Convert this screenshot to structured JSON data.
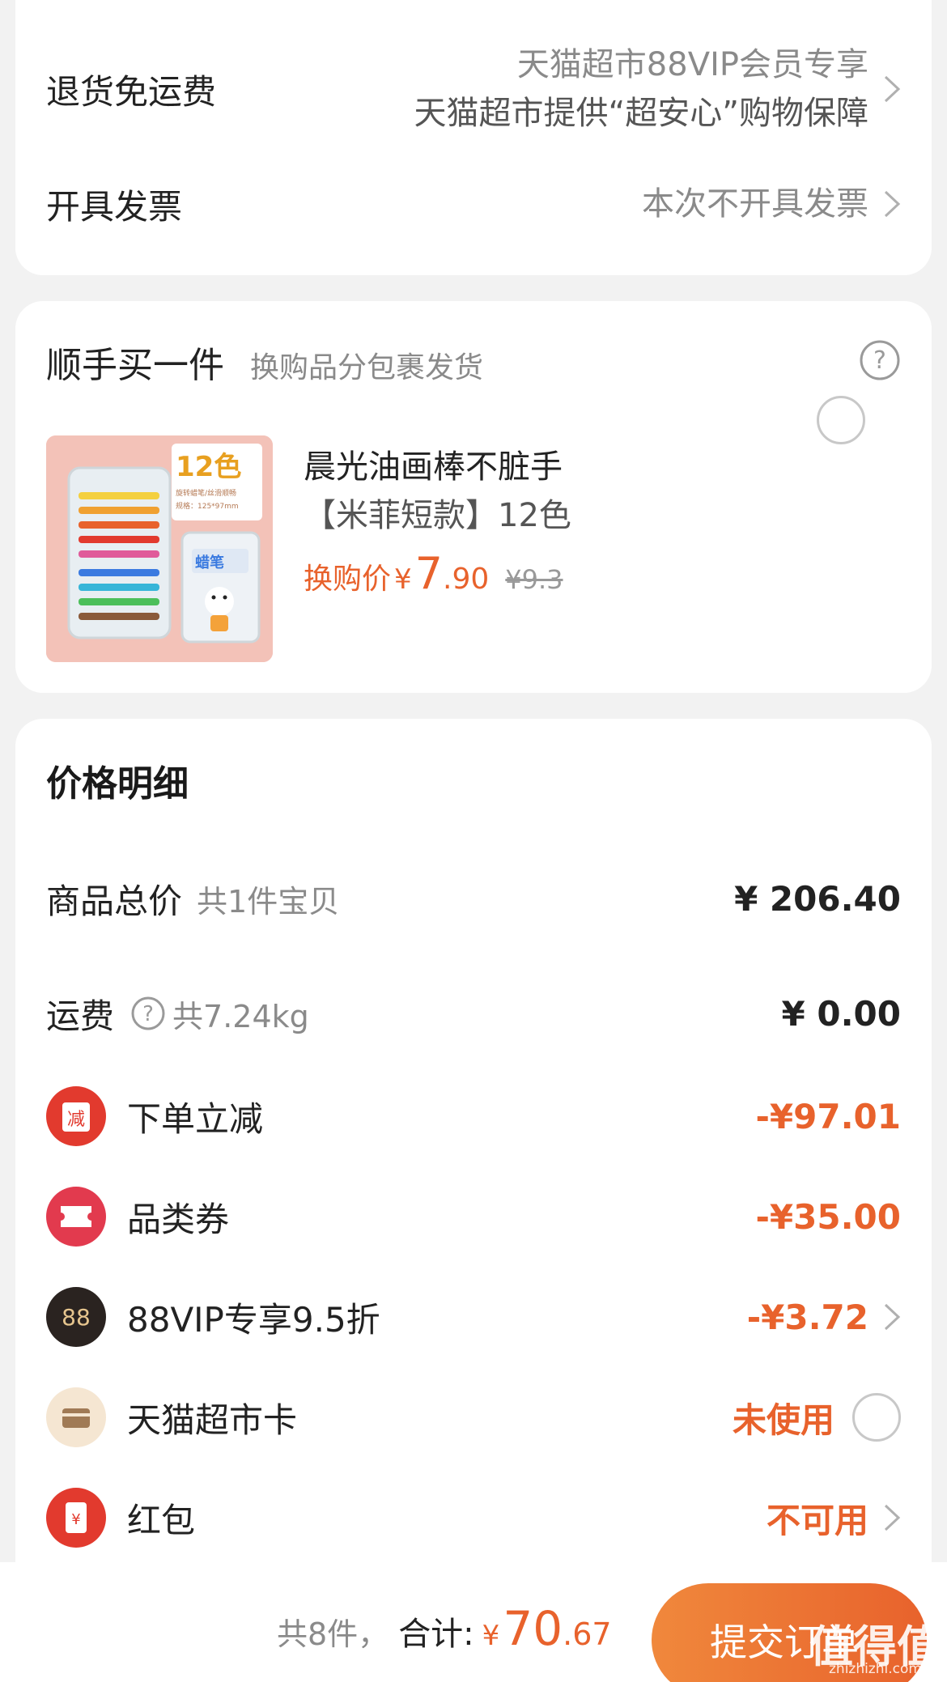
{
  "shipping": {
    "return_label": "退货免运费",
    "return_value_line1": "天猫超市88VIP会员专享",
    "return_value_line2": "天猫超市提供“超安心”购物保障",
    "invoice_label": "开具发票",
    "invoice_value": "本次不开具发票"
  },
  "addon": {
    "title": "顺手买一件",
    "subtitle": "换购品分包裹发货",
    "product_title": "晨光油画棒不脏手",
    "product_variant": "【米菲短款】12色",
    "price_prefix": "换购价",
    "currency": "¥",
    "price_int": "7",
    "price_dec": ".90",
    "original_price": "¥9.3",
    "image_badge": "12色",
    "image_note1": "旋转蜡笔/丝滑顺畅",
    "image_note2": "规格：125*97mm",
    "image_box_text": "蜡笔"
  },
  "price_detail": {
    "title": "价格明细",
    "rows": [
      {
        "label": "商品总价",
        "sub": "共1件宝贝",
        "value": "¥ 206.40"
      },
      {
        "label": "运费",
        "sub": "共7.24kg",
        "value": "¥ 0.00"
      },
      {
        "label": "下单立减",
        "value": "-¥97.01",
        "icon": "reduce-icon",
        "icon_text": "减"
      },
      {
        "label": "品类券",
        "value": "-¥35.00",
        "icon": "coupon-icon"
      },
      {
        "label": "88VIP专享9.5折",
        "value": "-¥3.72",
        "icon": "vip88-icon",
        "icon_text": "88"
      },
      {
        "label": "天猫超市卡",
        "value": "未使用",
        "icon": "card-icon"
      },
      {
        "label": "红包",
        "value": "不可用",
        "icon": "red-packet-icon",
        "icon_text": "¥"
      }
    ]
  },
  "footer": {
    "count": "共8件，",
    "total_label": "合计:",
    "currency": "¥",
    "total_int": "70",
    "total_dec": ".67",
    "submit_label": "提交订单",
    "watermark": "值得值",
    "watermark_url": "zhizhizhi.com"
  },
  "colors": {
    "accent": "#e8622c",
    "red": "#e23a2e",
    "page_bg": "#f2f2f2"
  }
}
